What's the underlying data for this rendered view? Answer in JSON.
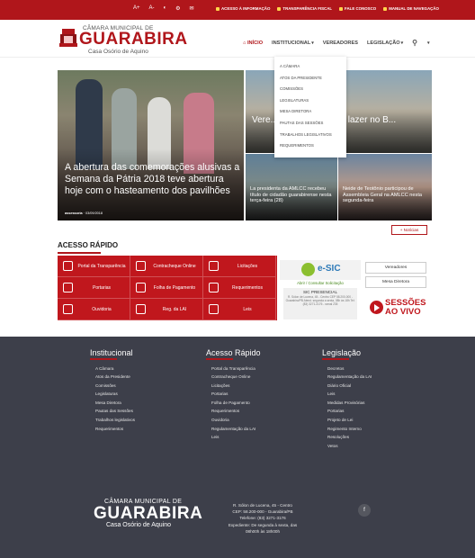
{
  "topbar": {
    "icons": [
      "A+",
      "A-",
      "◐",
      "⚙",
      "✉"
    ],
    "links": [
      "ACESSO À INFORMAÇÃO",
      "TRANSPARÊNCIA FISCAL",
      "FALE CONOSCO",
      "MANUAL DE NAVEGAÇÃO"
    ]
  },
  "header": {
    "logo_top": "CÂMARA MUNICIPAL DE",
    "logo_main": "GUARABIRA",
    "logo_sub": "Casa Osório de Aquino",
    "nav": {
      "inicio": "INÍCIO",
      "institucional": "INSTITUCIONAL",
      "vereadores": "VEREADORES",
      "legislacao": "LEGISLAÇÃO"
    }
  },
  "dropdown": [
    "A CÂMARA",
    "ATOS DA PRESIDENTE",
    "COMISSÕES",
    "LEGISLATURAS",
    "MESA DIRETORA",
    "PAUTAS DAS SESSÕES",
    "TRABALHOS LEGISLATIVOS",
    "REQUERIMENTOS"
  ],
  "hero": {
    "main_title": "A abertura das comemorações alusivas a Semana da Pátria 2018 teve abertura hoje com o hasteamento dos pavilhões",
    "main_author": "assessoria",
    "main_date": "03/09/2018",
    "top_right_title": "Vere... da inau... rea de lazer no B...",
    "bottom_left_title": "La presidenta da AMLCC recebeu título de cidadão guarabirense nesta terça-feira (28)",
    "bottom_right_title": "Neide de Teotônio participou de Assembleia Geral na AMLCC nesta segunda-feira",
    "more_button": "+ Notícias"
  },
  "acesso": {
    "title": "ACESSO RÁPIDO",
    "items": [
      {
        "label": "Portal da Transparência",
        "icon": "coins-icon"
      },
      {
        "label": "Contracheque Online",
        "icon": "payslip-icon"
      },
      {
        "label": "Licitações",
        "icon": "gavel-icon"
      },
      {
        "label": "Portarias",
        "icon": "document-icon"
      },
      {
        "label": "Folha de Pagamento",
        "icon": "payroll-icon"
      },
      {
        "label": "Requerimentos",
        "icon": "form-icon"
      },
      {
        "label": "Ouvidoria",
        "icon": "headset-icon"
      },
      {
        "label": "Reg. da LAI",
        "icon": "regulation-icon"
      },
      {
        "label": "Leis",
        "icon": "law-icon"
      }
    ]
  },
  "esic": {
    "name": "e-SIC",
    "solicit": "Abrir / Consultar Solicitação",
    "presencial": "SIC PRESENCIAL",
    "details": "R. Sólon de Lucena, 45 - Centro CEP 58.200-000 - Guarabira/PB Atend. segunda a sexta, 08h às 18h Tel: (83) 3271-3176 - ramal 235"
  },
  "side": {
    "vereadores": "Vereadores",
    "mesa": "Mesa Diretora",
    "sessoes": "SESSÕES AO VIVO"
  },
  "footer": {
    "institucional": {
      "title": "Institucional",
      "items": [
        "A Câmara",
        "Atos da Presidente",
        "Comissões",
        "Legislaturas",
        "Mesa Diretora",
        "Pautas das Sessões",
        "Trabalhos legislativos",
        "Requerimentos"
      ]
    },
    "acesso": {
      "title": "Acesso Rápido",
      "items": [
        "Portal da Transparência",
        "Contracheque Online",
        "Licitações",
        "Portarias",
        "Folha de Pagamento",
        "Requerimentos",
        "Ouvidoria",
        "Regulamentação da LAI",
        "Leis"
      ]
    },
    "legislacao": {
      "title": "Legislação",
      "items": [
        "Decretos",
        "Regulamentação da LAI",
        "Diário Oficial",
        "Leis",
        "Medidas Provisórias",
        "Portarias",
        "Projeto de Lei",
        "Regimento Interno",
        "Resoluções",
        "Vetos"
      ]
    },
    "logo_top": "CÂMARA MUNICIPAL DE",
    "logo_main": "GUARABIRA",
    "logo_sub": "Casa Osório de Aquino",
    "address": [
      "R. Sólon de Lucena, 45 - Centro",
      "CEP: 58.200-000 - Guarabira/PB",
      "Telefone: (83) 3271-3176",
      "Expediente: De segunda à sexta, das",
      "08h00h às 18h00h"
    ],
    "facebook": "f"
  },
  "colors": {
    "brand": "#b0161b",
    "footer": "#3d3f4a"
  }
}
